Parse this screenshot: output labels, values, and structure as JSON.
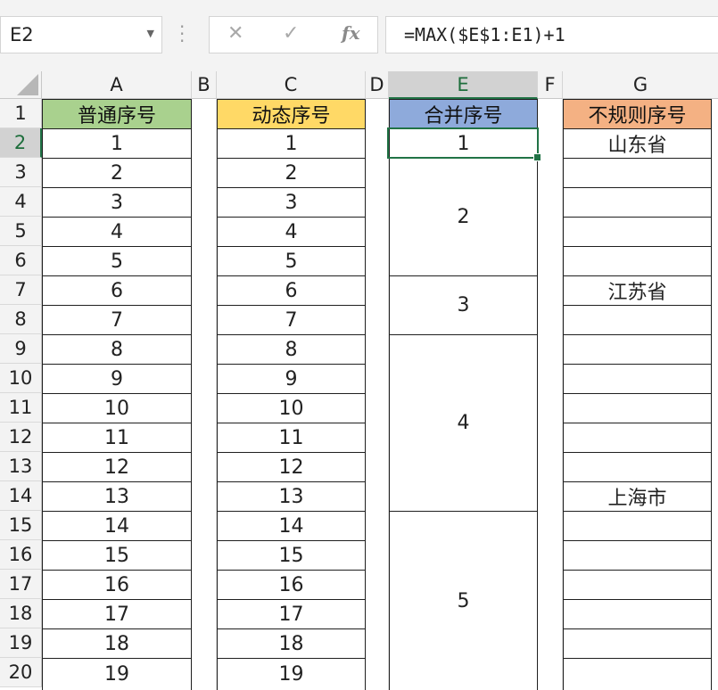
{
  "formula_bar": {
    "name_box": "E2",
    "cancel_icon": "✕",
    "enter_icon": "✓",
    "fx_label": "fx",
    "formula": "=MAX($E$1:E1)+1"
  },
  "columns": [
    "A",
    "B",
    "C",
    "D",
    "E",
    "F",
    "G"
  ],
  "rows": [
    "1",
    "2",
    "3",
    "4",
    "5",
    "6",
    "7",
    "8",
    "9",
    "10",
    "11",
    "12",
    "13",
    "14",
    "15",
    "16",
    "17",
    "18",
    "19",
    "20"
  ],
  "headers": {
    "A": "普通序号",
    "C": "动态序号",
    "E": "合并序号",
    "G": "不规则序号"
  },
  "column_a": [
    "1",
    "2",
    "3",
    "4",
    "5",
    "6",
    "7",
    "8",
    "9",
    "10",
    "11",
    "12",
    "13",
    "14",
    "15",
    "16",
    "17",
    "18",
    "19"
  ],
  "column_c": [
    "1",
    "2",
    "3",
    "4",
    "5",
    "6",
    "7",
    "8",
    "9",
    "10",
    "11",
    "12",
    "13",
    "14",
    "15",
    "16",
    "17",
    "18",
    "19"
  ],
  "merged_e": [
    {
      "rows": "2",
      "value": "1"
    },
    {
      "rows": "3-6",
      "value": "2"
    },
    {
      "rows": "7-8",
      "value": "3"
    },
    {
      "rows": "9-14",
      "value": "4"
    },
    {
      "rows": "15-20",
      "value": "5"
    }
  ],
  "column_g": {
    "row2": "山东省",
    "row7": "江苏省",
    "row14": "上海市"
  },
  "colors": {
    "header_a": "#a9d18e",
    "header_c": "#ffd966",
    "header_e": "#8eaadb",
    "header_g": "#f4b183",
    "selection": "#217346"
  }
}
